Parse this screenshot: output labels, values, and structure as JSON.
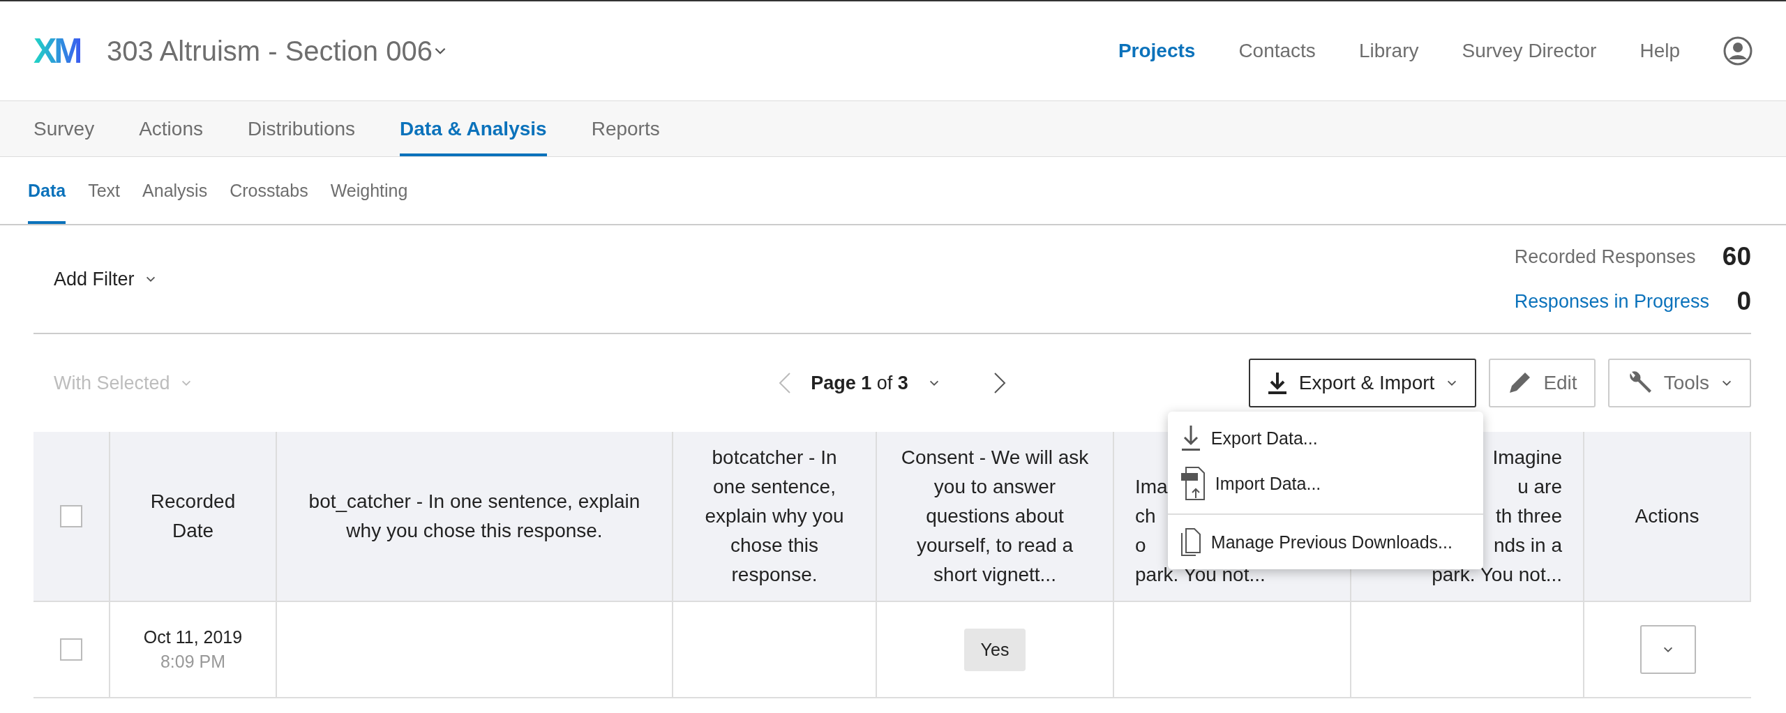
{
  "header": {
    "logo": "XM",
    "project_title": "303 Altruism - Section 006",
    "nav": [
      {
        "label": "Projects",
        "selected": true
      },
      {
        "label": "Contacts",
        "selected": false
      },
      {
        "label": "Library",
        "selected": false
      },
      {
        "label": "Survey Director",
        "selected": false
      },
      {
        "label": "Help",
        "selected": false
      }
    ]
  },
  "tabs": [
    {
      "label": "Survey",
      "selected": false
    },
    {
      "label": "Actions",
      "selected": false
    },
    {
      "label": "Distributions",
      "selected": false
    },
    {
      "label": "Data & Analysis",
      "selected": true
    },
    {
      "label": "Reports",
      "selected": false
    }
  ],
  "subtabs": [
    {
      "label": "Data",
      "selected": true
    },
    {
      "label": "Text",
      "selected": false
    },
    {
      "label": "Analysis",
      "selected": false
    },
    {
      "label": "Crosstabs",
      "selected": false
    },
    {
      "label": "Weighting",
      "selected": false
    }
  ],
  "filter": {
    "label": "Add Filter"
  },
  "counts": [
    {
      "label": "Recorded Responses",
      "value": "60",
      "kind": "plain"
    },
    {
      "label": "Responses in Progress",
      "value": "0",
      "kind": "link"
    }
  ],
  "toolbar": {
    "with_selected": {
      "label": "With Selected",
      "disabled": true
    },
    "pager": {
      "page_word": "Page",
      "page": "1",
      "of_word": "of",
      "total": "3"
    },
    "buttons": [
      {
        "label": "Export & Import",
        "kind": "export",
        "open": true
      },
      {
        "label": "Edit",
        "kind": "edit",
        "open": false
      },
      {
        "label": "Tools",
        "kind": "tools",
        "open": false
      }
    ]
  },
  "menu": {
    "items": [
      {
        "label": "Export Data...",
        "kind": "export"
      },
      {
        "label": "Import Data...",
        "kind": "import"
      },
      {
        "label": "Manage Previous Downloads...",
        "kind": "downloads"
      }
    ]
  },
  "table": {
    "columns": [
      {
        "kind": "checkbox",
        "checked": false
      },
      {
        "kind": "full",
        "title": "Recorded Date"
      },
      {
        "kind": "full",
        "title": "bot_catcher - In one sentence, explain why you chose this response."
      },
      {
        "kind": "full",
        "title": "botcatcher - In one sentence, explain why you chose this response."
      },
      {
        "kind": "full",
        "title": "Consent - We will ask you to answer questions about yourself, to read a short vignett..."
      },
      {
        "kind": "cut_right",
        "lines": [
          "Ima",
          "ch",
          "o",
          "park. You not..."
        ]
      },
      {
        "kind": "cut_left",
        "lines": [
          "Imagine",
          "u are",
          "th three",
          "nds in a",
          "park. You not..."
        ]
      },
      {
        "kind": "full",
        "title": "Actions"
      }
    ],
    "rows": [
      {
        "cells": [
          {
            "kind": "checkbox",
            "checked": false
          },
          {
            "kind": "datetime",
            "date": "Oct 11, 2019",
            "time": "8:09 PM"
          },
          {
            "kind": "empty"
          },
          {
            "kind": "empty"
          },
          {
            "kind": "tag",
            "text": "Yes"
          },
          {
            "kind": "empty"
          },
          {
            "kind": "empty"
          },
          {
            "kind": "actions"
          }
        ]
      }
    ]
  }
}
